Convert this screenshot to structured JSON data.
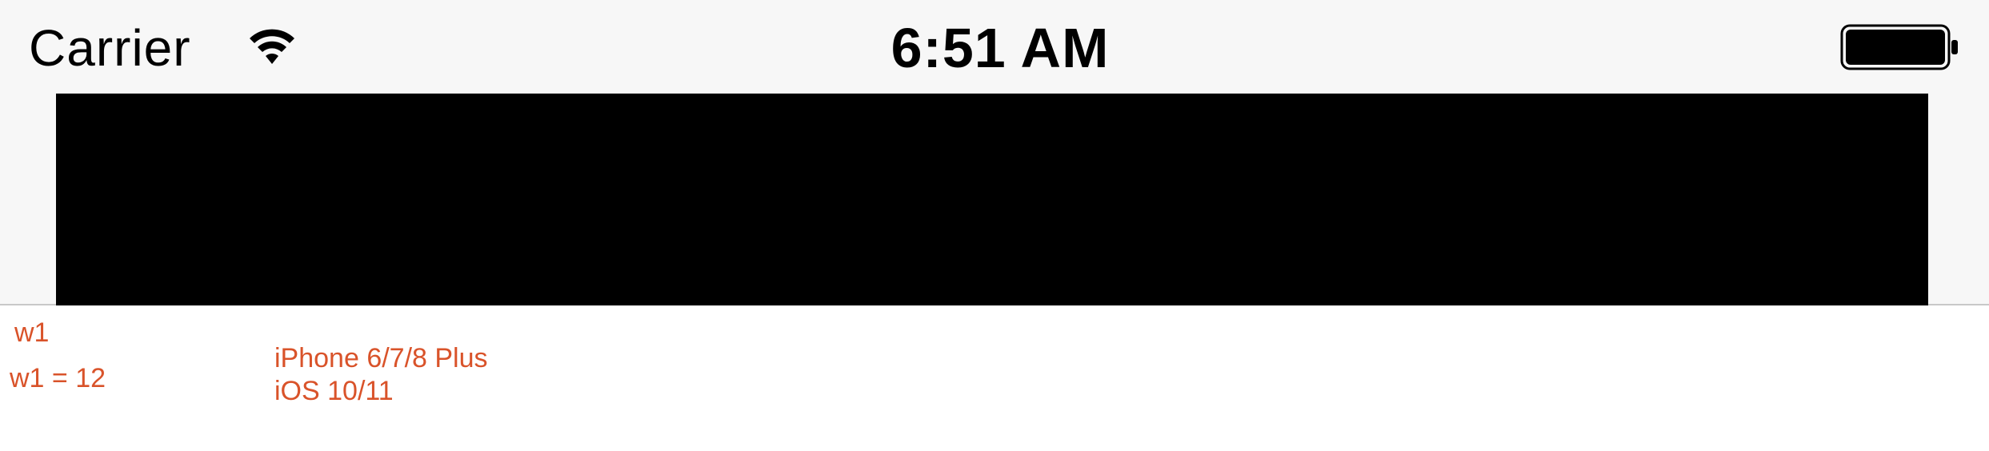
{
  "status_bar": {
    "carrier": "Carrier",
    "time": "6:51 AM",
    "wifi_icon": "wifi-icon",
    "battery_icon": "battery-icon"
  },
  "annotations": {
    "w1_label": "w1",
    "w1_value": "w1 = 12",
    "device": "iPhone 6/7/8 Plus",
    "os": "iOS 10/11"
  },
  "colors": {
    "annotation": "#d9532a",
    "bar": "#000000",
    "top_background": "#f7f7f7"
  }
}
